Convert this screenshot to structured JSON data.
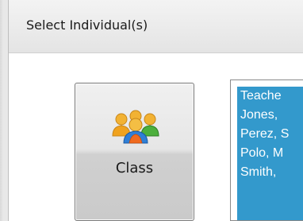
{
  "window": {
    "title": "Select Individual(s)"
  },
  "class_button": {
    "label": "Class",
    "icon": "group-users-icon"
  },
  "list": {
    "items": [
      "Teache",
      "Jones,",
      "Perez, S",
      "Polo, M",
      "Smith,"
    ]
  },
  "colors": {
    "list_highlight": "#3399cc",
    "titlebar": "#eaeaea"
  }
}
